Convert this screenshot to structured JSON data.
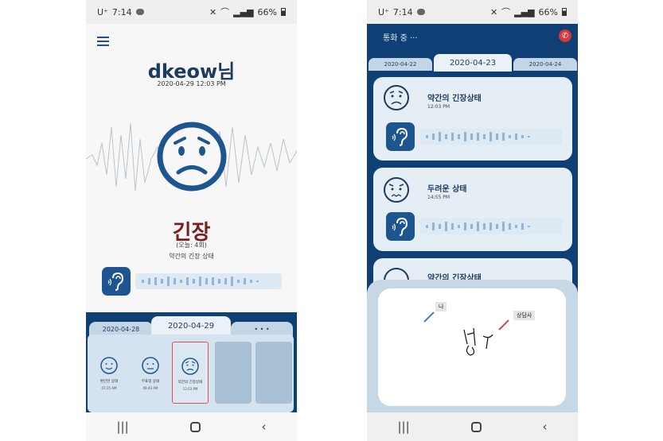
{
  "status_bar": {
    "carrier": "U⁺",
    "time": "7:14",
    "battery": "66%"
  },
  "left_screen": {
    "user_name": "dkeow님",
    "datetime": "2020-04-29 12:03 PM",
    "emotion_title": "긴장",
    "emotion_count": "(오늘: 4회)",
    "emotion_desc": "약간의 긴장 상태",
    "tabs": [
      {
        "label": "2020-04-28",
        "active": false
      },
      {
        "label": "2020-04-29",
        "active": true
      },
      {
        "label": "• • •",
        "active": false
      }
    ],
    "cards": [
      {
        "label": "편안한 상태",
        "time": "07:25 AM",
        "face": "smile"
      },
      {
        "label": "무표정 상태",
        "time": "09:43 AM",
        "face": "neutral"
      },
      {
        "label": "약간의 긴장상태",
        "time": "12:03 PM",
        "face": "worried",
        "selected": true
      }
    ]
  },
  "right_screen": {
    "call_label": "통화 중 ···",
    "tabs": [
      {
        "label": "2020-04-22",
        "active": false
      },
      {
        "label": "2020-04-23",
        "active": true
      },
      {
        "label": "2020-04-24",
        "active": false
      }
    ],
    "records": [
      {
        "title": "약간의 긴장상태",
        "time": "12:03 PM"
      },
      {
        "title": "두려운 상태",
        "time": "14:55 PM"
      },
      {
        "title": "약간의 긴장상태",
        "time": ""
      }
    ],
    "sign": {
      "me_label": "나",
      "counselor_label": "상담사"
    }
  },
  "colors": {
    "primary": "#0e3f75",
    "face": "#1d5591",
    "emotion": "#7a1d22",
    "end_call": "#d93838"
  }
}
